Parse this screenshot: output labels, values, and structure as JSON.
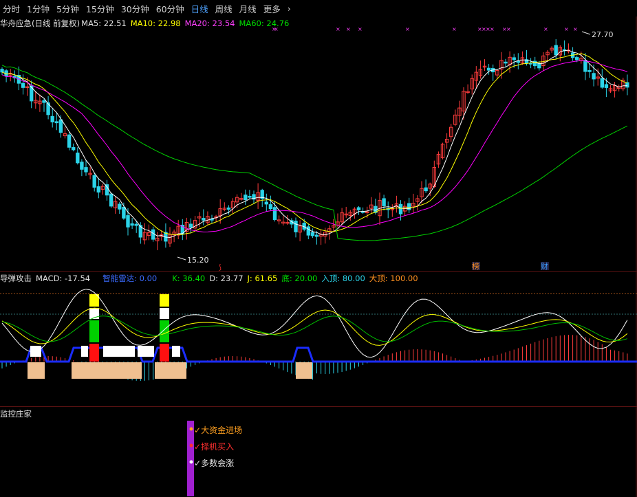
{
  "toolbar": {
    "tabs": [
      {
        "label": "分时",
        "active": false
      },
      {
        "label": "1分钟",
        "active": false
      },
      {
        "label": "5分钟",
        "active": false
      },
      {
        "label": "15分钟",
        "active": false
      },
      {
        "label": "30分钟",
        "active": false
      },
      {
        "label": "60分钟",
        "active": false
      },
      {
        "label": "日线",
        "active": true
      },
      {
        "label": "周线",
        "active": false
      },
      {
        "label": "月线",
        "active": false
      },
      {
        "label": "更多",
        "active": false
      }
    ]
  },
  "main_panel": {
    "title": "华舟应急(日线 前复权)",
    "ma5": "MA5: 22.51",
    "ma10": "MA10: 22.98",
    "ma20": "MA20: 23.54",
    "ma60": "MA60: 24.76",
    "high_marker": "27.70",
    "low_marker": "15.20",
    "event_tags": [
      "榜",
      "财"
    ]
  },
  "macd_panel": {
    "name": "导弹攻击",
    "macd": "MACD: -17.54",
    "radar": "智能雷达: 0.00",
    "k": "K: 36.40",
    "d": "D: 23.77",
    "j": "J: 61.65",
    "bottom": "底: 20.00",
    "enter_top": "入顶: 80.00",
    "big_top": "大顶: 100.00"
  },
  "monitor_panel": {
    "name": "监控庄家",
    "signals": [
      "大资金进场",
      "择机买入",
      "多数会涨"
    ]
  },
  "colors": {
    "up": "#ff3c3c",
    "down": "#2bd3e8",
    "ma5": "#ffffff",
    "ma10": "#ffff00",
    "ma20": "#ff00ff",
    "ma60": "#00d000",
    "active_tab": "#4fa3ff"
  }
}
